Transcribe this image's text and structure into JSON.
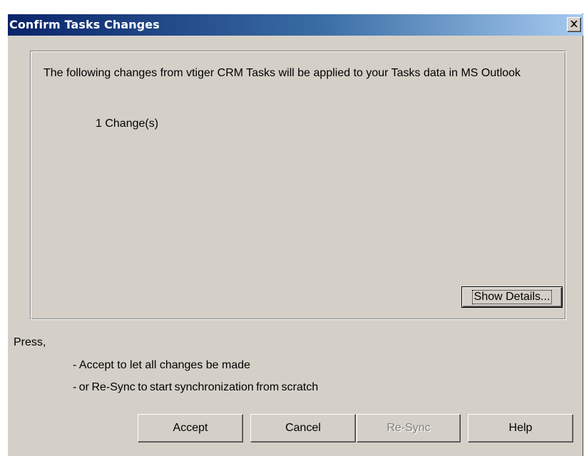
{
  "dialog": {
    "title": "Confirm Tasks Changes",
    "close_glyph": "close-icon"
  },
  "summary": {
    "message": "The following changes from vtiger CRM Tasks will be applied to your Tasks data in MS Outlook",
    "count": "1 Change(s)",
    "show_details_label": "Show Details..."
  },
  "instructions": {
    "press": "Press,",
    "line1": "- Accept to let all changes be made",
    "line2": "- or  Re-Sync to start synchronization from scratch"
  },
  "buttons": {
    "accept": "Accept",
    "cancel": "Cancel",
    "resync": "Re-Sync",
    "help": "Help"
  },
  "colors": {
    "dialog_face": "#d4d0c8",
    "title_gradient_start": "#0a246a",
    "title_gradient_end": "#a6caf0",
    "disabled_text": "#808080"
  }
}
